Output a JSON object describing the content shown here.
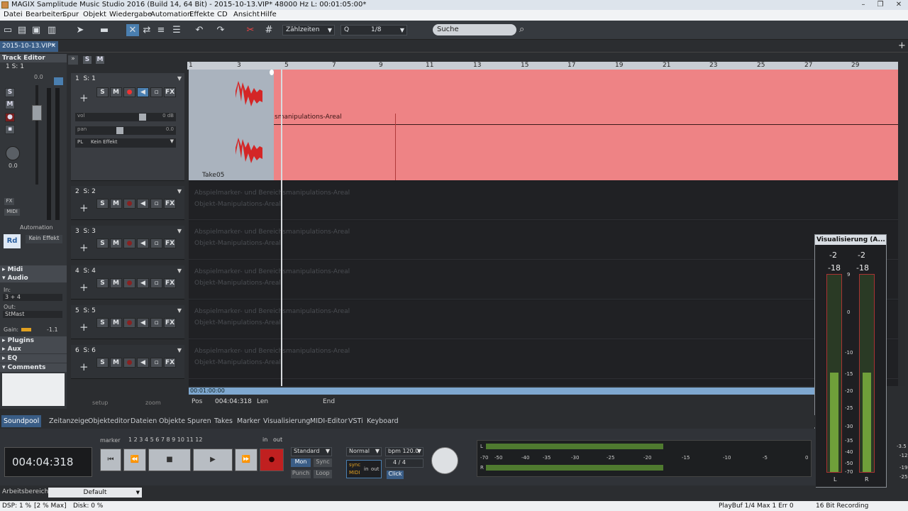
{
  "window": {
    "title": "MAGIX Samplitude Music Studio 2016 (Build 14, 64 Bit)  -  2015-10-13.VIP*   48000 Hz L: 00:01:05:00*"
  },
  "menu": [
    "Datei",
    "Bearbeiten",
    "Spur",
    "Objekt",
    "Wiedergabe",
    "Automation",
    "Effekte",
    "CD",
    "Ansicht",
    "Hilfe"
  ],
  "toolbar": {
    "grid_mode": "Zählzeiten",
    "quantize_label": "Q",
    "quantize_value": "1/8",
    "search_placeholder": "Suche"
  },
  "doc_tab": "2015-10-13.VIP*",
  "track_editor": {
    "header": "Track Editor",
    "selector": "1   S: 1",
    "solo": "S",
    "mute": "M",
    "volume_scale": "0.0",
    "pan_value": "0.0",
    "automation_label": "Automation",
    "read_mode": "Rd",
    "effect": "Kein Effekt",
    "fx_label": "FX",
    "midi_label": "MIDI"
  },
  "sections": {
    "midi": "Midi",
    "audio": "Audio",
    "in_label": "In:",
    "in_value": "3 + 4",
    "out_label": "Out:",
    "out_value": "StMast",
    "gain_label": "Gain:",
    "gain_value": "-1.1",
    "plugins": "Plugins",
    "aux": "Aux",
    "eq": "EQ",
    "comments": "Comments"
  },
  "tracks": [
    {
      "num": "1",
      "name": "S: 1",
      "vol_label": "vol",
      "vol_value": "0 dB",
      "pan_label": "pan",
      "pan_value": "0.0",
      "pl_label": "PL",
      "effect": "Kein Effekt"
    },
    {
      "num": "2",
      "name": "S: 2"
    },
    {
      "num": "3",
      "name": "S: 3"
    },
    {
      "num": "4",
      "name": "S: 4"
    },
    {
      "num": "5",
      "name": "S: 5"
    },
    {
      "num": "6",
      "name": "S: 6"
    }
  ],
  "track_buttons": {
    "s": "S",
    "m": "M",
    "fx": "FX"
  },
  "ruler": [
    "1",
    "3",
    "5",
    "7",
    "9",
    "11",
    "13",
    "15",
    "17",
    "19",
    "21",
    "23",
    "25",
    "27",
    "29"
  ],
  "arrange": {
    "clip_name": "Take05",
    "lane_hint": "smanipulations-Areal",
    "hint1": "Abspielmarker- und Bereichsmanipulations-Areal",
    "hint2": "Objekt-Manipulations-Areal"
  },
  "position": {
    "time": "00:01:00:00",
    "pos_label": "Pos",
    "pos_value": "004:04:318",
    "len_label": "Len",
    "end_label": "End"
  },
  "setup_label": "setup",
  "zoom_label": "zoom",
  "bottom_tabs": [
    "Soundpool",
    "Zeitanzeige",
    "Objekteditor",
    "Dateien",
    "Objekte",
    "Spuren",
    "Takes",
    "Marker",
    "Visualisierung",
    "MIDI-Editor",
    "VSTi",
    "Keyboard"
  ],
  "transport": {
    "time": "004:04:318",
    "marker_label": "marker",
    "markers": [
      "1",
      "2",
      "3",
      "4",
      "5",
      "6",
      "7",
      "8",
      "9",
      "10",
      "11",
      "12"
    ],
    "in_label": "in",
    "out_label": "out",
    "mode": "Standard",
    "mon": "Mon",
    "sync": "Sync",
    "punch": "Punch",
    "loop": "Loop",
    "play_mode": "Normal",
    "bpm": "bpm 120.0",
    "signature": "4 / 4",
    "click": "Click",
    "sync_small": "sync",
    "midi_small": "MIDI",
    "in_small": "in",
    "out_small": "out"
  },
  "meter_scale": [
    "-70",
    "-50",
    "-40",
    "-35",
    "-30",
    "-25",
    "-20",
    "-15",
    "-10",
    "-5",
    "0"
  ],
  "visualization": {
    "title": "Visualisierung (A...",
    "peak_left": "-2",
    "peak_right": "-2",
    "rms_left": "-18",
    "rms_right": "-18",
    "scale": [
      "9",
      "0",
      "-10",
      "-15",
      "-20",
      "-25",
      "-30",
      "-35",
      "-40",
      "-50",
      "-70"
    ],
    "left": "L",
    "right": "R"
  },
  "right_scale": [
    "-3.5",
    "-12",
    "-19",
    "-25"
  ],
  "workarea": {
    "label": "Arbeitsbereich:",
    "value": "Default"
  },
  "status": {
    "dsp": "DSP: 1 %",
    "dsp_max": "[2 % Max]",
    "disk": "Disk:  0 %",
    "playbuf": "PlayBuf 1/4  Max 1  Err 0",
    "rec": "16 Bit Recording"
  },
  "colors": {
    "lane1": "#ee8385",
    "clip": "#aab3be",
    "record": "#cc2222",
    "accent": "#3a5d86"
  }
}
